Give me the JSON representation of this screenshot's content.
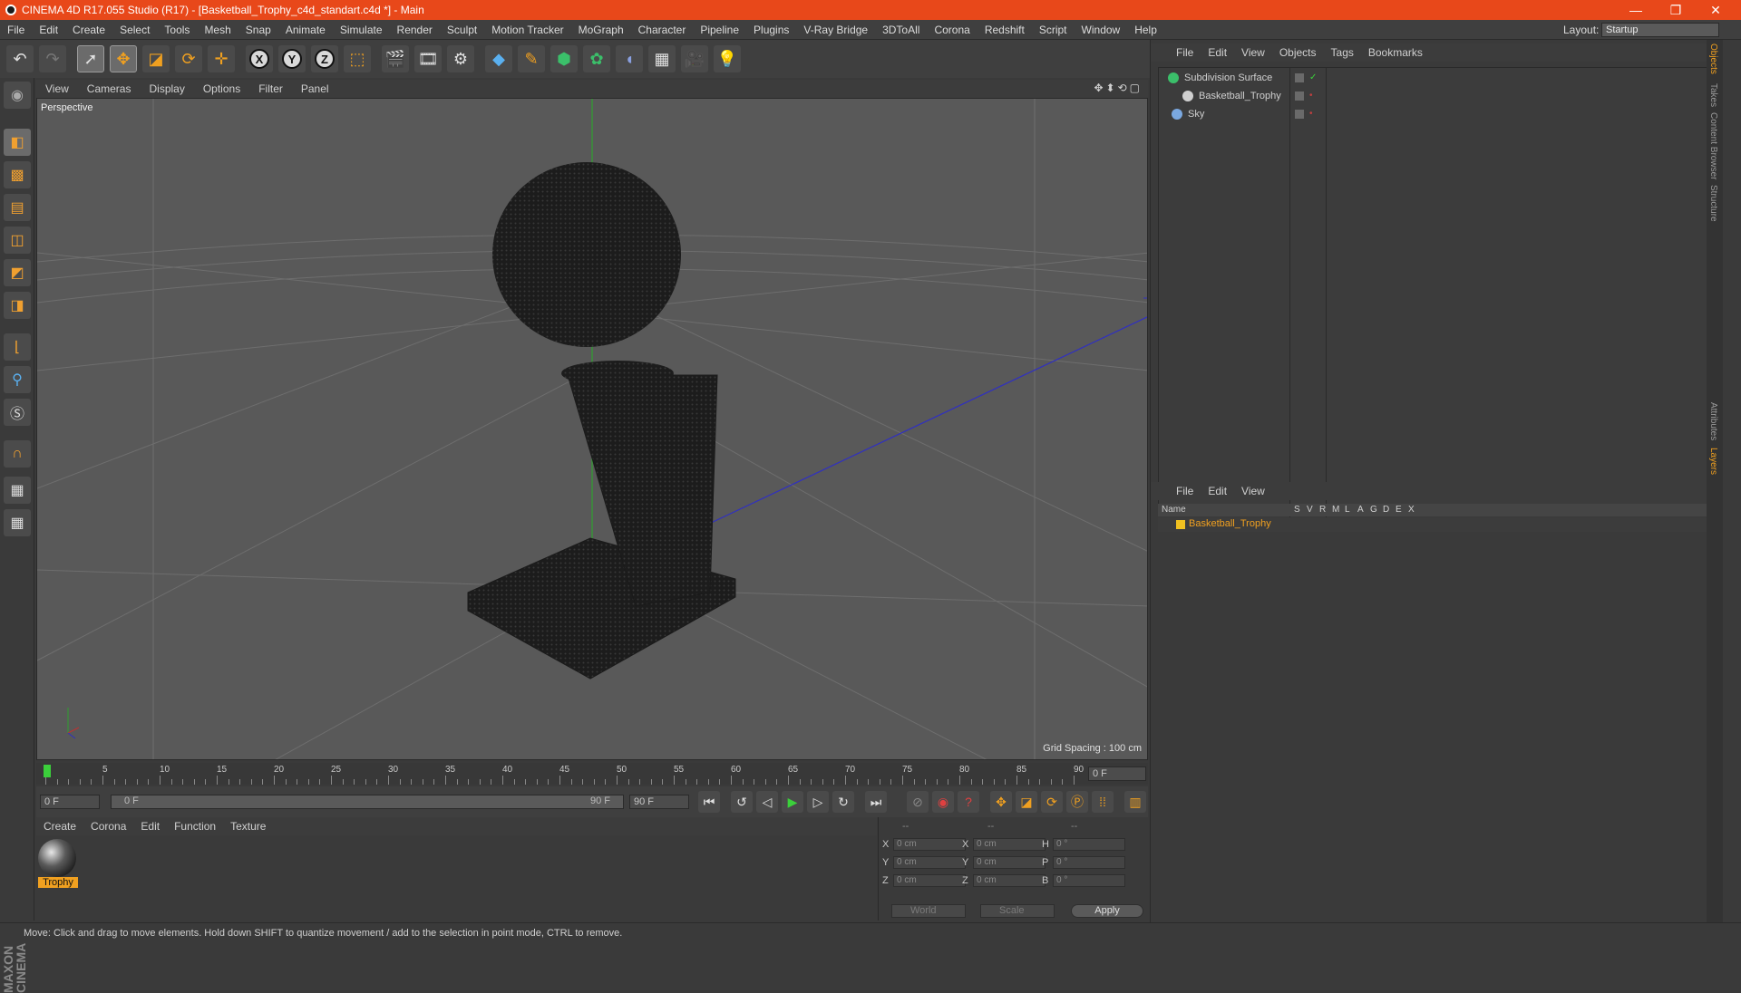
{
  "window": {
    "title": "CINEMA 4D R17.055 Studio (R17) - [Basketball_Trophy_c4d_standart.c4d *] - Main"
  },
  "menubar": {
    "items": [
      "File",
      "Edit",
      "Create",
      "Select",
      "Tools",
      "Mesh",
      "Snap",
      "Animate",
      "Simulate",
      "Render",
      "Sculpt",
      "Motion Tracker",
      "MoGraph",
      "Character",
      "Pipeline",
      "Plugins",
      "V-Ray Bridge",
      "3DToAll",
      "Corona",
      "Redshift",
      "Script",
      "Window",
      "Help"
    ],
    "layout_label": "Layout:",
    "layout_value": "Startup"
  },
  "viewport": {
    "menu": [
      "View",
      "Cameras",
      "Display",
      "Options",
      "Filter",
      "Panel"
    ],
    "label": "Perspective",
    "grid_spacing": "Grid Spacing : 100 cm"
  },
  "timeline": {
    "ticks": [
      "0",
      "5",
      "10",
      "15",
      "20",
      "25",
      "30",
      "35",
      "40",
      "45",
      "50",
      "55",
      "60",
      "65",
      "70",
      "75",
      "80",
      "85",
      "90"
    ],
    "current_frame": "0 F",
    "start_field": "0 F",
    "range_start": "0 F",
    "range_end": "90 F",
    "end_field": "90 F"
  },
  "material_manager": {
    "menu": [
      "Create",
      "Corona",
      "Edit",
      "Function",
      "Texture"
    ],
    "materials": [
      {
        "name": "Trophy"
      }
    ]
  },
  "coordinates": {
    "headers": [
      "--",
      "--",
      "--"
    ],
    "rows": [
      {
        "a": "X",
        "av": "0 cm",
        "b": "X",
        "bv": "0 cm",
        "c": "H",
        "cv": "0 °"
      },
      {
        "a": "Y",
        "av": "0 cm",
        "b": "Y",
        "bv": "0 cm",
        "c": "P",
        "cv": "0 °"
      },
      {
        "a": "Z",
        "av": "0 cm",
        "b": "Z",
        "bv": "0 cm",
        "c": "B",
        "cv": "0 °"
      }
    ],
    "mode1": "World",
    "mode2": "Scale",
    "apply": "Apply"
  },
  "object_manager": {
    "menu": [
      "File",
      "Edit",
      "View",
      "Objects",
      "Tags",
      "Bookmarks"
    ],
    "objects": [
      {
        "name": "Subdivision Surface",
        "color": "#3bbf6a"
      },
      {
        "name": "Basketball_Trophy",
        "color": "#d0d0d0"
      },
      {
        "name": "Sky",
        "color": "#7aa8e0"
      }
    ]
  },
  "layer_manager": {
    "menu": [
      "File",
      "Edit",
      "View"
    ],
    "columns": [
      "Name",
      "S",
      "V",
      "R",
      "M",
      "L",
      "A",
      "G",
      "D",
      "E",
      "X"
    ],
    "layers": [
      {
        "name": "Basketball_Trophy",
        "color": "#f0c020"
      }
    ]
  },
  "side_tabs": [
    "Objects",
    "Takes",
    "Content Browser",
    "Structure",
    "Attributes",
    "Layers"
  ],
  "status": "Move: Click and drag to move elements. Hold down SHIFT to quantize movement / add to the selection in point mode, CTRL to remove.",
  "colors": {
    "titlebar": "#e8481a",
    "accent": "#f0a020"
  }
}
